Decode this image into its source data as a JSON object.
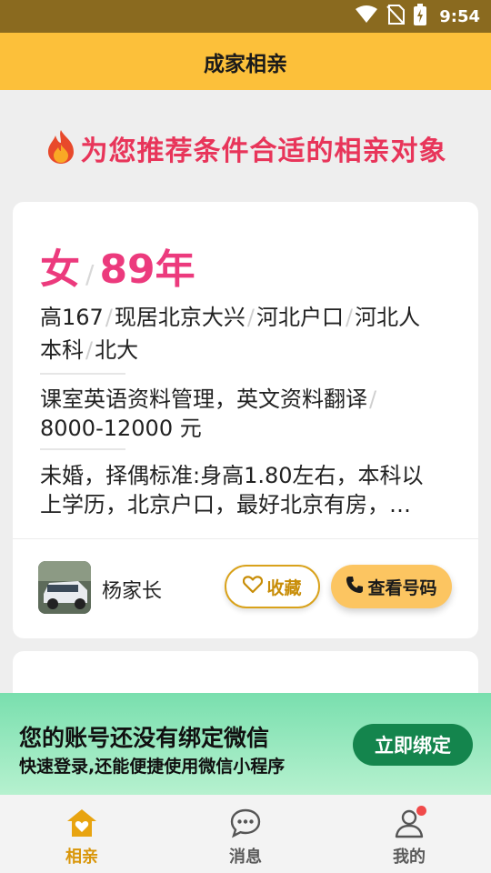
{
  "status_bar": {
    "time": "9:54"
  },
  "header": {
    "title": "成家相亲"
  },
  "promo": {
    "text": "为您推荐条件合适的相亲对象",
    "icon": "fire-icon"
  },
  "card": {
    "gender": "女",
    "birth_year": "89年",
    "tags_line1": [
      "高167",
      "现居北京大兴",
      "河北户口",
      "河北人"
    ],
    "tags_line2": [
      "本科",
      "北大"
    ],
    "job": "课室英语资料管理，英文资料翻译",
    "salary": "8000-12000 元",
    "description_line1": "未婚，择偶标准:身高1.80左右，本科以",
    "description_line2": "上学历，北京户口，最好北京有房，…",
    "parent_name": "杨家长",
    "fav_label": "收藏",
    "view_phone_label": "查看号码"
  },
  "bind_banner": {
    "title": "您的账号还没有绑定微信",
    "subtitle": "快速登录,还能便捷使用微信小程序",
    "button_label": "立即绑定"
  },
  "tabs": [
    {
      "label": "相亲",
      "icon": "home-heart-icon",
      "active": true
    },
    {
      "label": "消息",
      "icon": "chat-bubble-icon",
      "active": false
    },
    {
      "label": "我的",
      "icon": "user-icon",
      "active": false
    }
  ],
  "colors": {
    "accent": "#fcc03a",
    "promo_red": "#e8355a",
    "headline_pink": "#ec3a7d",
    "bind_green": "#14854d"
  }
}
